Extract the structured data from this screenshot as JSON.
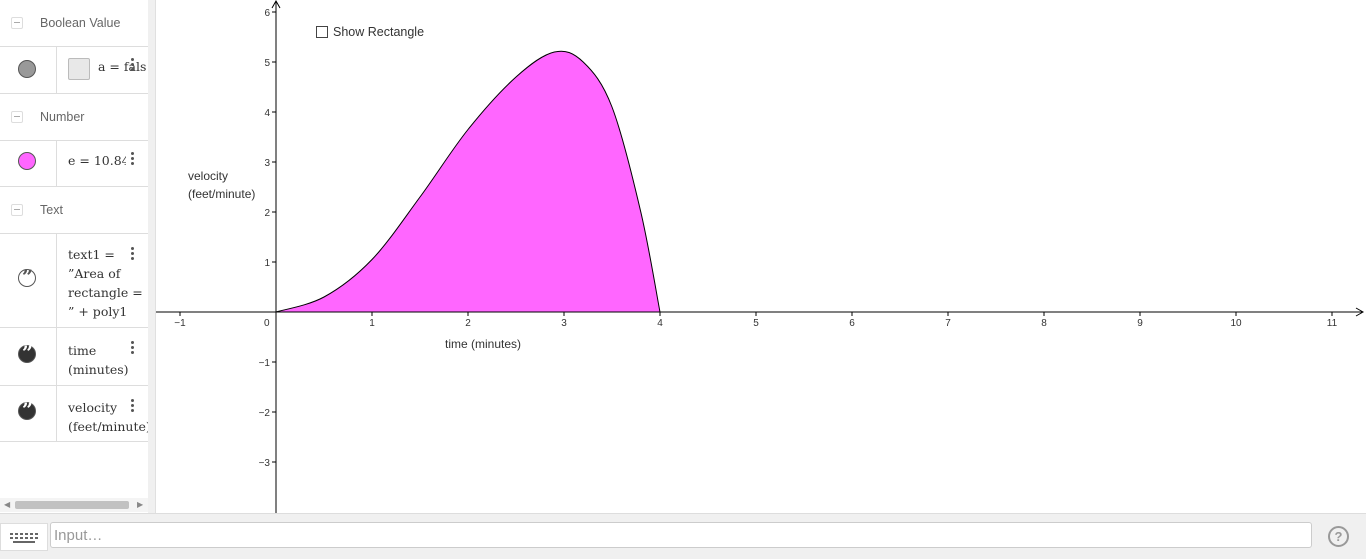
{
  "algebra": {
    "groups": [
      {
        "label": "Boolean Value"
      },
      {
        "label": "Number"
      },
      {
        "label": "Text"
      }
    ],
    "items": [
      {
        "text": "a = fals",
        "color": "#999999"
      },
      {
        "text": "e = 10.84",
        "color": "#ff66ff"
      },
      {
        "text": "text1 =\n”Area of\nrectangle =\n” + poly1",
        "color": "#ffffff"
      },
      {
        "text": "time\n(minutes)",
        "color": "#333333"
      },
      {
        "text": "velocity\n(feet/minute)",
        "color": "#333333"
      }
    ]
  },
  "graphics": {
    "checkbox_label": "Show Rectangle",
    "x_axis_label": "time (minutes)",
    "y_axis_label_line1": "velocity",
    "y_axis_label_line2": "(feet/minute)",
    "fill_color": "#ff66ff",
    "x_ticks": [
      "−1",
      "0",
      "1",
      "2",
      "3",
      "4",
      "5",
      "6",
      "7",
      "8",
      "9",
      "10",
      "11"
    ],
    "y_ticks": [
      "−3",
      "−2",
      "−1",
      "1",
      "2",
      "3",
      "4",
      "5",
      "6"
    ]
  },
  "chart_data": {
    "type": "area",
    "x": [
      0,
      0.5,
      1,
      1.5,
      2,
      2.5,
      2.9,
      3.2,
      3.5,
      3.8,
      4
    ],
    "y": [
      0,
      0.3,
      1.05,
      2.3,
      3.65,
      4.7,
      5.2,
      5.0,
      4.1,
      2.0,
      0
    ],
    "xlim": [
      -1.2,
      11.4
    ],
    "ylim": [
      -4,
      6.2
    ],
    "xlabel": "time (minutes)",
    "ylabel": "velocity (feet/minute)",
    "grid": false
  },
  "input_bar": {
    "placeholder": "Input…",
    "help": "?"
  }
}
